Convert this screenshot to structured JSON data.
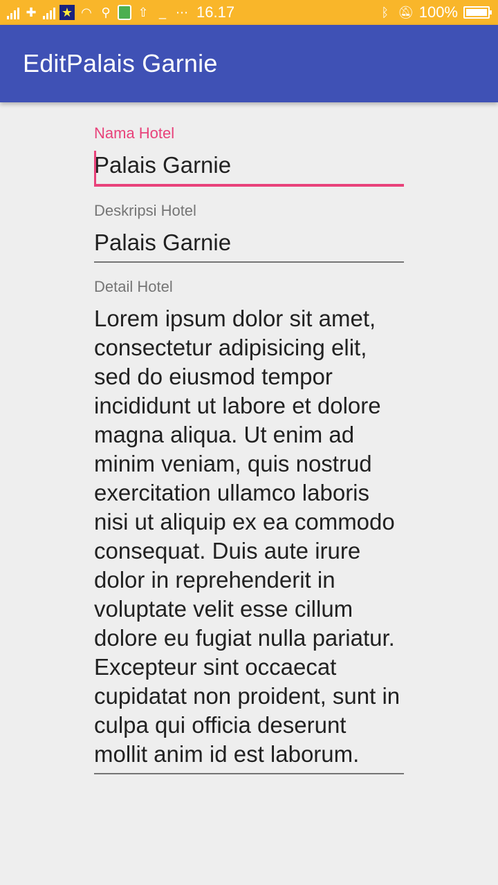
{
  "status_bar": {
    "time": "16.17",
    "battery_percent": "100%",
    "icons": [
      "signal-icon",
      "carrier-icon",
      "signal-icon",
      "star-icon",
      "wifi-icon",
      "usb-icon",
      "battery-green-icon",
      "upload-icon",
      "minus-icon",
      "more-icon",
      "bluetooth-icon",
      "mute-icon",
      "battery-icon"
    ]
  },
  "app_bar": {
    "title": "EditPalais Garnie",
    "color": "#3f51b5"
  },
  "form": {
    "nama_label": "Nama Hotel",
    "nama_value": "Palais Garnie",
    "deskripsi_label": "Deskripsi Hotel",
    "deskripsi_value": "Palais Garnie",
    "detail_label": "Detail Hotel",
    "detail_value": "Lorem ipsum dolor sit amet, consectetur adipisicing elit, sed do eiusmod tempor incididunt ut labore et dolore magna aliqua. Ut enim ad minim veniam, quis nostrud exercitation ullamco laboris nisi ut aliquip ex ea commodo consequat. Duis aute irure dolor in reprehenderit in voluptate velit esse cillum dolore eu fugiat nulla pariatur. Excepteur sint occaecat cupidatat non proident, sunt in culpa qui officia deserunt mollit anim id est laborum."
  },
  "colors": {
    "accent": "#e8427a",
    "status_bar": "#f9b62a",
    "background": "#eeeeee"
  }
}
